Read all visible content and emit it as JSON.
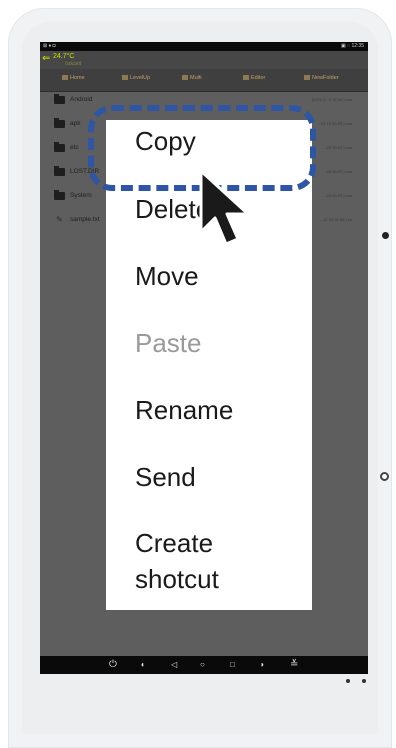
{
  "status": {
    "left": "⊠ ♦ ◘",
    "right": "▣ ◌  12:35"
  },
  "titlebar": {
    "temp": "24.7°C",
    "path": "/sdcard"
  },
  "toolbar": {
    "items": [
      "Home",
      "LevelUp",
      "Multi",
      "Editor",
      "NewFolder"
    ]
  },
  "files": [
    {
      "name": "Android",
      "meta": "[2022-0...9 12:00 ] drw"
    },
    {
      "name": "apk",
      "meta": "...03 10:43:28 ] drw"
    },
    {
      "name": "etc",
      "meta": "...20 20:22 ] drw"
    },
    {
      "name": "LOST.DIR",
      "meta": "...06:48:00 ] drw"
    },
    {
      "name": "System",
      "meta": "...20:09:29 ] drw"
    },
    {
      "name": "sample.txt",
      "meta": "...21 09:31:06 ] rw"
    }
  ],
  "menu": {
    "items": [
      {
        "label": "Copy"
      },
      {
        "label": "Delete"
      },
      {
        "label": "Move"
      },
      {
        "label": "Paste"
      },
      {
        "label": "Rename"
      },
      {
        "label": "Send"
      },
      {
        "label": "Create"
      },
      {
        "label": "shotcut"
      }
    ]
  },
  "colors": {
    "accent": "#2f55a5",
    "menu_bg": "#ffffff",
    "disabled": "#9a9a9a"
  },
  "icons": [
    "back-icon",
    "home-icon",
    "folder-icon",
    "text-file-icon",
    "pointer-cursor-icon",
    "power-icon",
    "volume-icon",
    "back-nav-icon",
    "home-nav-icon",
    "recents-icon",
    "screenshot-icon",
    "collapse-icon"
  ]
}
